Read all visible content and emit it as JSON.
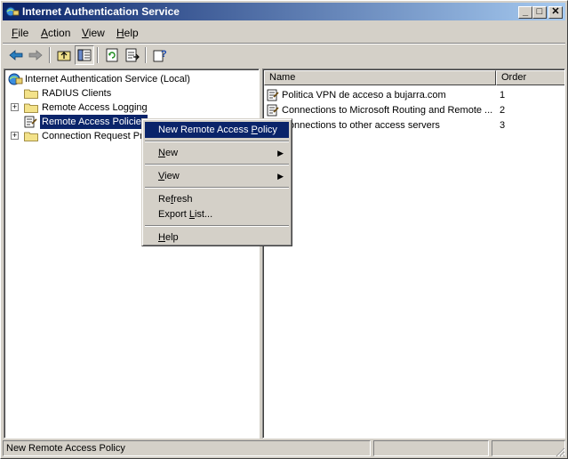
{
  "window": {
    "title": "Internet Authentication Service",
    "min": "_",
    "max": "□",
    "close": "✕"
  },
  "menu": {
    "file": {
      "accel": "F",
      "rest": "ile"
    },
    "action": {
      "accel": "A",
      "rest": "ction"
    },
    "view": {
      "accel": "V",
      "rest": "iew"
    },
    "help": {
      "accel": "H",
      "rest": "elp"
    }
  },
  "toolbar": [
    "back-icon",
    "forward-icon",
    "up-one-level-icon",
    "show-hide-tree-icon",
    "refresh-icon",
    "export-list-icon",
    "help-icon"
  ],
  "tree": {
    "root": "Internet Authentication Service (Local)",
    "items": [
      {
        "label": "RADIUS Clients",
        "expander": ""
      },
      {
        "label": "Remote Access Logging",
        "expander": "+"
      },
      {
        "label": "Remote Access Policies",
        "expander": ""
      },
      {
        "label": "Connection Request Pr",
        "expander": "+"
      }
    ]
  },
  "list": {
    "columns": {
      "name": "Name",
      "order": "Order"
    },
    "rows": [
      {
        "name": "Politica VPN de acceso a bujarra.com",
        "order": "1"
      },
      {
        "name": "Connections to Microsoft Routing and Remote ...",
        "order": "2"
      },
      {
        "name": "Connections to other access servers",
        "order": "3"
      }
    ]
  },
  "context_menu": {
    "new_policy": {
      "pre": "New Remote Access ",
      "accel": "P",
      "post": "olicy"
    },
    "new": {
      "accel": "N",
      "rest": "ew"
    },
    "view": {
      "accel": "V",
      "rest": "iew"
    },
    "refresh": {
      "pre": "Re",
      "accel": "f",
      "post": "resh"
    },
    "export": {
      "pre": "Export ",
      "accel": "L",
      "post": "ist..."
    },
    "help": {
      "accel": "H",
      "rest": "elp"
    }
  },
  "status": {
    "text": "New Remote Access Policy",
    "panels": [
      "",
      ""
    ]
  },
  "colors": {
    "selection": "#0a246a",
    "face": "#d4d0c8",
    "title_start": "#0a246a",
    "title_end": "#a6caf0"
  }
}
